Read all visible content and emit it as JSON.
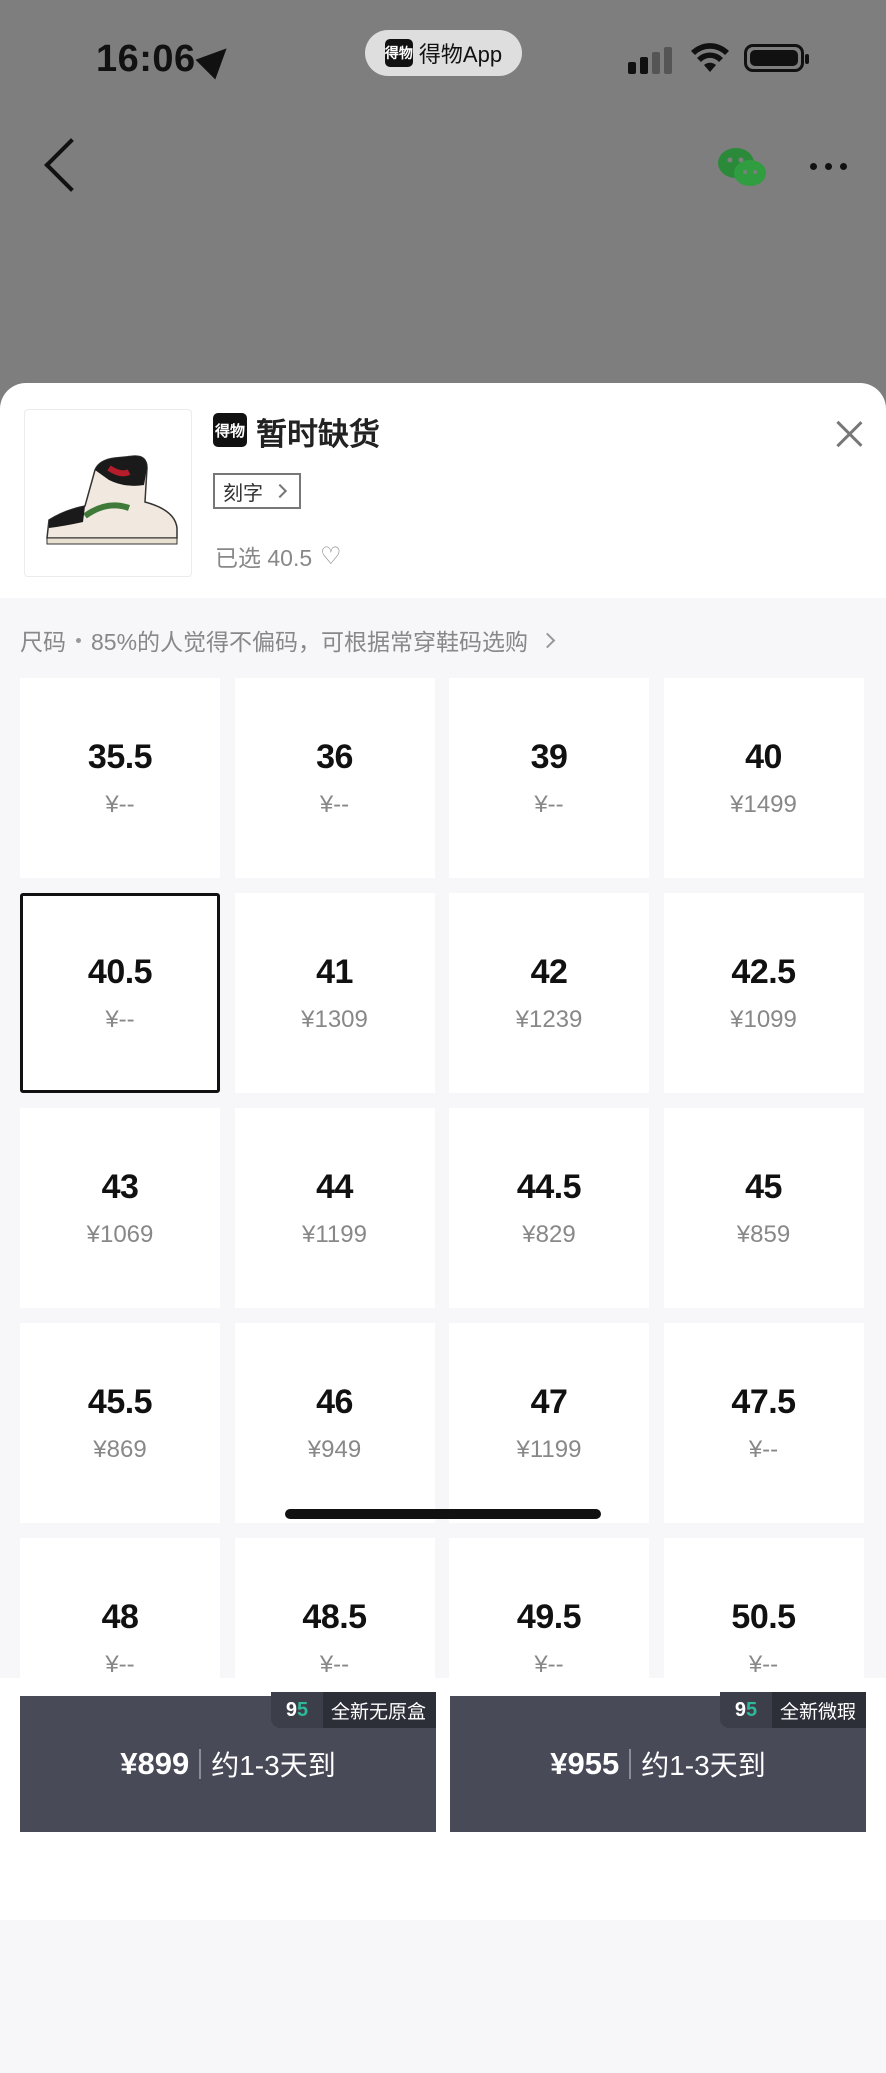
{
  "status_bar": {
    "time": "16:06",
    "app_pill": {
      "logo": "得物",
      "name": "得物App"
    }
  },
  "nav": {
    "back_icon": "chevron-left-icon",
    "share_icon": "wechat-icon",
    "more_icon": "more-dots-icon"
  },
  "sheet": {
    "brand_logo": "得物",
    "status_title": "暂时缺货",
    "engrave_label": "刻字",
    "selected_text": "已选 40.5",
    "size_hint": {
      "label": "尺码",
      "text": "85%的人觉得不偏码，可根据常穿鞋码选购"
    }
  },
  "sizes": [
    {
      "size": "35.5",
      "price": "¥--"
    },
    {
      "size": "36",
      "price": "¥--"
    },
    {
      "size": "39",
      "price": "¥--"
    },
    {
      "size": "40",
      "price": "¥1499"
    },
    {
      "size": "40.5",
      "price": "¥--",
      "selected": true
    },
    {
      "size": "41",
      "price": "¥1309"
    },
    {
      "size": "42",
      "price": "¥1239"
    },
    {
      "size": "42.5",
      "price": "¥1099"
    },
    {
      "size": "43",
      "price": "¥1069"
    },
    {
      "size": "44",
      "price": "¥1199"
    },
    {
      "size": "44.5",
      "price": "¥829"
    },
    {
      "size": "45",
      "price": "¥859"
    },
    {
      "size": "45.5",
      "price": "¥869"
    },
    {
      "size": "46",
      "price": "¥949"
    },
    {
      "size": "47",
      "price": "¥1199"
    },
    {
      "size": "47.5",
      "price": "¥--"
    },
    {
      "size": "48",
      "price": "¥--"
    },
    {
      "size": "48.5",
      "price": "¥--"
    },
    {
      "size": "49.5",
      "price": "¥--"
    },
    {
      "size": "50.5",
      "price": "¥--"
    }
  ],
  "buy_options": [
    {
      "tag_badge": "95",
      "tag": "全新无原盒",
      "price": "¥899",
      "eta": "约1-3天到"
    },
    {
      "tag_badge": "95",
      "tag": "全新微瑕",
      "price": "¥955",
      "eta": "约1-3天到"
    }
  ],
  "colors": {
    "buy_button": "#484a58",
    "teal_accent": "#2fb79a",
    "panel_bg": "#f7f6f9"
  }
}
